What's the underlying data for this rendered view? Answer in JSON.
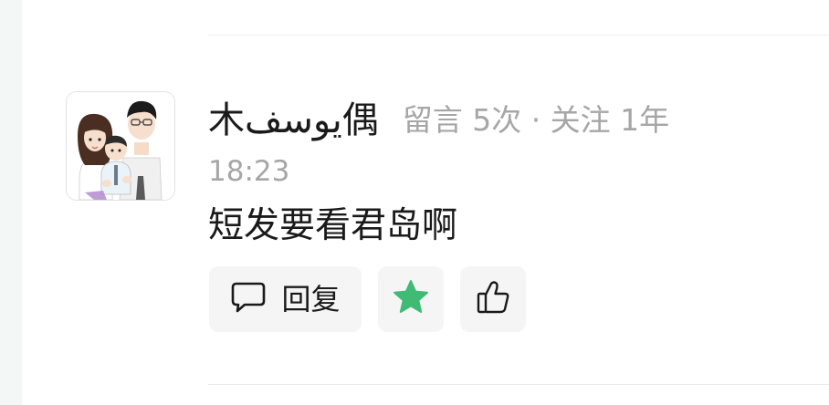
{
  "comment": {
    "username": "木يوسف偶",
    "meta": "留言 5次 · 关注 1年",
    "time": "18:23",
    "text": "短发要看君岛啊",
    "avatar_icon": "family-cartoon-avatar"
  },
  "actions": {
    "reply_label": "回复",
    "reply_icon": "chat-bubble-icon",
    "star_icon": "star-icon",
    "like_icon": "thumbs-up-icon",
    "star_color": "#3fbb73"
  }
}
